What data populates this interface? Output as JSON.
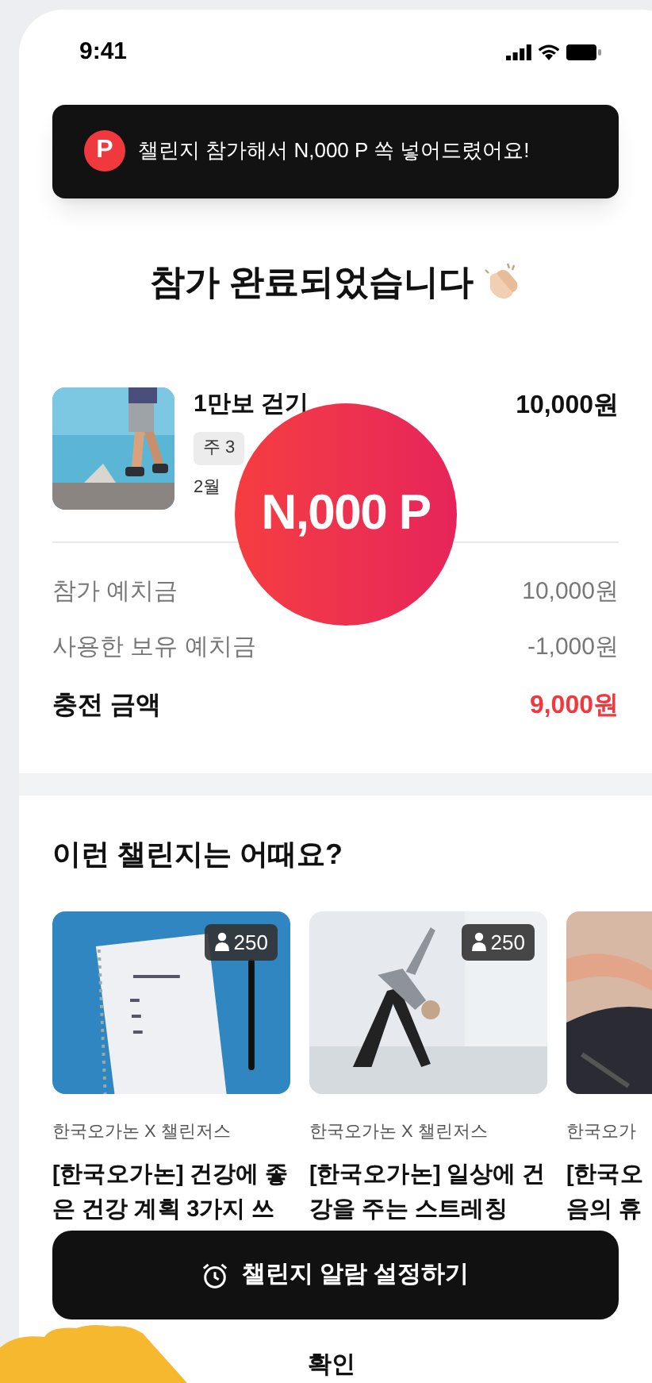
{
  "status_bar": {
    "time": "9:41"
  },
  "toast": {
    "icon_letter": "P",
    "message": "챌린지 참가해서 N,000 P 쏙 넣어드렸어요!"
  },
  "title": "참가 완료되었습니다",
  "challenge": {
    "name": "1만보 걷기",
    "tag": "주 3",
    "period": "2월",
    "price": "10,000원"
  },
  "points_badge": "N,000 P",
  "summary": [
    {
      "kind": "normal",
      "label": "참가 예치금",
      "value": "10,000원"
    },
    {
      "kind": "normal",
      "label": "사용한 보유 예치금",
      "value": "-1,000원"
    },
    {
      "kind": "total",
      "label": "충전 금액",
      "value": "9,000원"
    }
  ],
  "recommend": {
    "heading": "이런 챌린지는 어때요?",
    "cards": [
      {
        "kind": "picture",
        "count": "250",
        "org": "한국오가논 X 챌린저스",
        "title_lines": [
          "[한국오가논] 건강에 좋",
          "은 건강 계획 3가지 쓰"
        ]
      },
      {
        "kind": "picture",
        "count": "250",
        "org": "한국오가논 X 챌린저스",
        "title_lines": [
          "[한국오가논] 일상에 건",
          "강을 주는 스트레칭"
        ]
      },
      {
        "kind": "picture",
        "org": "한국오가",
        "title_lines": [
          "[한국오",
          "음의 휴"
        ]
      }
    ]
  },
  "primary_button": "챌린지 알람 설정하기",
  "secondary_button": "확인"
}
